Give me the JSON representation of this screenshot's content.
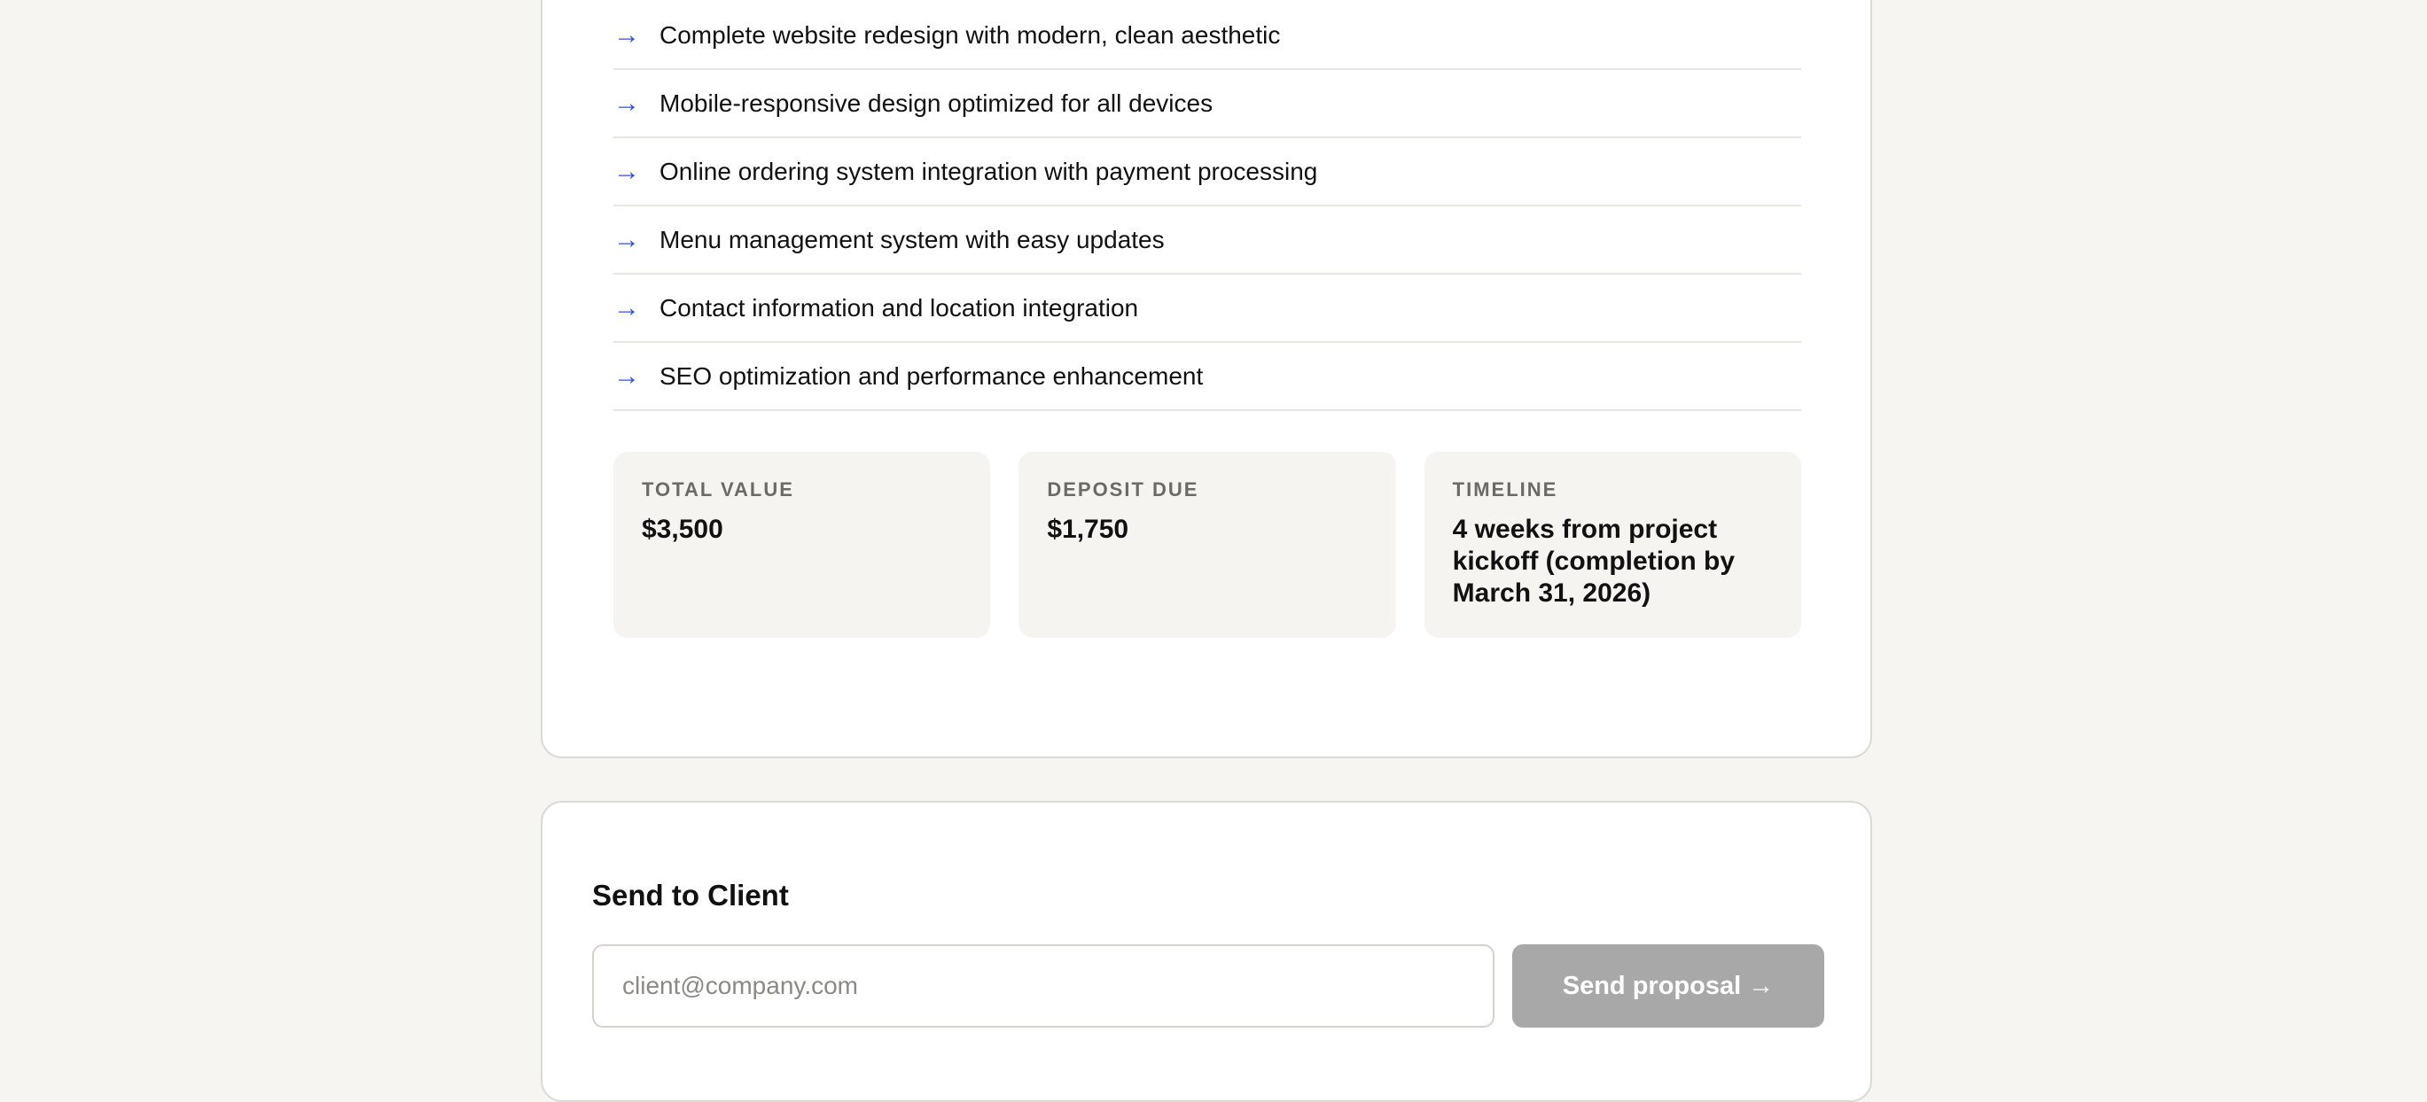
{
  "deliverables": {
    "arrow_glyph": "→",
    "items": [
      "Complete website redesign with modern, clean aesthetic",
      "Mobile-responsive design optimized for all devices",
      "Online ordering system integration with payment processing",
      "Menu management system with easy updates",
      "Contact information and location integration",
      "SEO optimization and performance enhancement"
    ]
  },
  "summary": {
    "total_value": {
      "label": "TOTAL VALUE",
      "value": "$3,500"
    },
    "deposit_due": {
      "label": "DEPOSIT DUE",
      "value": "$1,750"
    },
    "timeline": {
      "label": "TIMELINE",
      "value": "4 weeks from project kickoff (completion by March 31, 2026)"
    }
  },
  "send": {
    "title": "Send to Client",
    "email_placeholder": "client@company.com",
    "email_value": "",
    "button_label": "Send proposal →"
  },
  "colors": {
    "accent_arrow": "#2f4fe0",
    "page_background": "#f6f5f1",
    "button_disabled": "#a8a8a8"
  },
  "icons": {
    "list_bullet": "arrow-right-icon"
  }
}
